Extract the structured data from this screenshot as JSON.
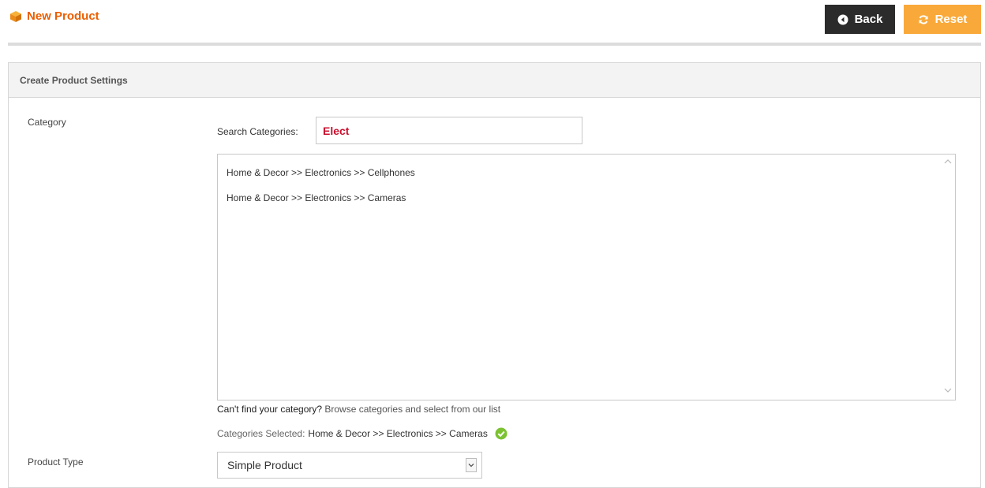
{
  "header": {
    "title": "New Product",
    "title_icon": "box-icon",
    "back_label": "Back",
    "reset_label": "Reset"
  },
  "colors": {
    "accent_orange": "#eb5e00",
    "back_button": "#2b2b2b",
    "reset_button": "#f9a93a",
    "search_text": "#c8102e",
    "check_green": "#7cc231"
  },
  "panel": {
    "title": "Create Product Settings",
    "category_label": "Category",
    "search": {
      "label": "Search Categories:",
      "value": "Elect"
    },
    "category_results": [
      "Home & Decor >> Electronics >> Cellphones",
      "Home & Decor >> Electronics >> Cameras"
    ],
    "cant_find_bold": "Can't find your category?",
    "cant_find_link": "Browse categories and select from our list",
    "selected_label": "Categories Selected:",
    "selected_value": "Home & Decor >> Electronics >> Cameras",
    "product_type_label": "Product Type",
    "product_type_value": "Simple Product"
  }
}
